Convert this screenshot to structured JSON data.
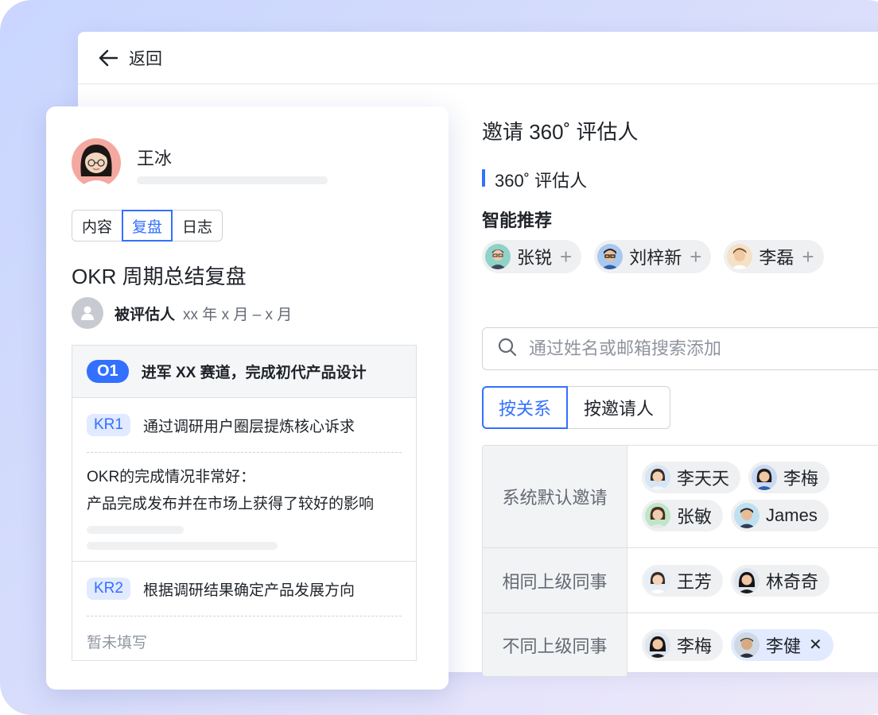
{
  "back": {
    "label": "返回"
  },
  "invite": {
    "title": "邀请 360˚ 评估人",
    "section_title": "360˚ 评估人",
    "smart_title": "智能推荐",
    "recommended": [
      {
        "name": "张锐",
        "avatar": "man-glasses"
      },
      {
        "name": "刘梓新",
        "avatar": "man-glasses-dark"
      },
      {
        "name": "李磊",
        "avatar": "man-brown-hair"
      }
    ],
    "search": {
      "placeholder": "通过姓名或邮箱搜索添加",
      "value": ""
    },
    "segments": [
      {
        "label": "按关系",
        "active": true
      },
      {
        "label": "按邀请人",
        "active": false
      }
    ],
    "groups": [
      {
        "label": "系统默认邀请",
        "people": [
          {
            "name": "李天天",
            "avatar": "woman-1",
            "selected": false
          },
          {
            "name": "李梅",
            "avatar": "woman-2",
            "selected": false
          },
          {
            "name": "张敏",
            "avatar": "woman-3",
            "selected": false
          },
          {
            "name": "James",
            "avatar": "man-1",
            "selected": false
          }
        ]
      },
      {
        "label": "相同上级同事",
        "people": [
          {
            "name": "王芳",
            "avatar": "woman-4",
            "selected": false
          },
          {
            "name": "林奇奇",
            "avatar": "woman-5",
            "selected": false
          }
        ]
      },
      {
        "label": "不同上级同事",
        "people": [
          {
            "name": "李梅",
            "avatar": "woman-2",
            "selected": false
          },
          {
            "name": "李健",
            "avatar": "man-2",
            "selected": true,
            "remove": "✕"
          }
        ]
      }
    ]
  },
  "card": {
    "user_name": "王冰",
    "tabs": [
      {
        "label": "内容",
        "active": false
      },
      {
        "label": "复盘",
        "active": true
      },
      {
        "label": "日志",
        "active": false
      }
    ],
    "title": "OKR 周期总结复盘",
    "reviewee_label": "被评估人",
    "reviewee_period": "xx 年 x 月 – x 月",
    "objective": {
      "badge": "O1",
      "text": "进军 XX 赛道，完成初代产品设计"
    },
    "krs": [
      {
        "badge": "KR1",
        "text": "通过调研用户圈层提炼核心诉求",
        "lines": [
          "OKR的完成情况非常好：",
          "产品完成发布并在市场上获得了较好的影响"
        ]
      },
      {
        "badge": "KR2",
        "text": "根据调研结果确定产品发展方向",
        "empty": "暂未填写"
      }
    ]
  },
  "colors": {
    "accent": "#3370ff",
    "accent_light": "#e1eaff",
    "chip": "#eff0f1"
  }
}
